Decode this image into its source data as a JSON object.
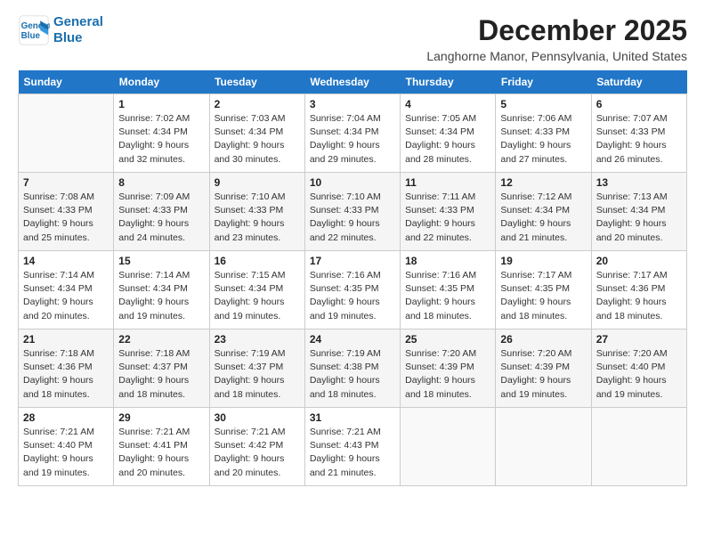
{
  "logo": {
    "line1": "General",
    "line2": "Blue"
  },
  "title": "December 2025",
  "location": "Langhorne Manor, Pennsylvania, United States",
  "days_of_week": [
    "Sunday",
    "Monday",
    "Tuesday",
    "Wednesday",
    "Thursday",
    "Friday",
    "Saturday"
  ],
  "weeks": [
    [
      {
        "day": "",
        "info": ""
      },
      {
        "day": "1",
        "info": "Sunrise: 7:02 AM\nSunset: 4:34 PM\nDaylight: 9 hours\nand 32 minutes."
      },
      {
        "day": "2",
        "info": "Sunrise: 7:03 AM\nSunset: 4:34 PM\nDaylight: 9 hours\nand 30 minutes."
      },
      {
        "day": "3",
        "info": "Sunrise: 7:04 AM\nSunset: 4:34 PM\nDaylight: 9 hours\nand 29 minutes."
      },
      {
        "day": "4",
        "info": "Sunrise: 7:05 AM\nSunset: 4:34 PM\nDaylight: 9 hours\nand 28 minutes."
      },
      {
        "day": "5",
        "info": "Sunrise: 7:06 AM\nSunset: 4:33 PM\nDaylight: 9 hours\nand 27 minutes."
      },
      {
        "day": "6",
        "info": "Sunrise: 7:07 AM\nSunset: 4:33 PM\nDaylight: 9 hours\nand 26 minutes."
      }
    ],
    [
      {
        "day": "7",
        "info": "Sunrise: 7:08 AM\nSunset: 4:33 PM\nDaylight: 9 hours\nand 25 minutes."
      },
      {
        "day": "8",
        "info": "Sunrise: 7:09 AM\nSunset: 4:33 PM\nDaylight: 9 hours\nand 24 minutes."
      },
      {
        "day": "9",
        "info": "Sunrise: 7:10 AM\nSunset: 4:33 PM\nDaylight: 9 hours\nand 23 minutes."
      },
      {
        "day": "10",
        "info": "Sunrise: 7:10 AM\nSunset: 4:33 PM\nDaylight: 9 hours\nand 22 minutes."
      },
      {
        "day": "11",
        "info": "Sunrise: 7:11 AM\nSunset: 4:33 PM\nDaylight: 9 hours\nand 22 minutes."
      },
      {
        "day": "12",
        "info": "Sunrise: 7:12 AM\nSunset: 4:34 PM\nDaylight: 9 hours\nand 21 minutes."
      },
      {
        "day": "13",
        "info": "Sunrise: 7:13 AM\nSunset: 4:34 PM\nDaylight: 9 hours\nand 20 minutes."
      }
    ],
    [
      {
        "day": "14",
        "info": "Sunrise: 7:14 AM\nSunset: 4:34 PM\nDaylight: 9 hours\nand 20 minutes."
      },
      {
        "day": "15",
        "info": "Sunrise: 7:14 AM\nSunset: 4:34 PM\nDaylight: 9 hours\nand 19 minutes."
      },
      {
        "day": "16",
        "info": "Sunrise: 7:15 AM\nSunset: 4:34 PM\nDaylight: 9 hours\nand 19 minutes."
      },
      {
        "day": "17",
        "info": "Sunrise: 7:16 AM\nSunset: 4:35 PM\nDaylight: 9 hours\nand 19 minutes."
      },
      {
        "day": "18",
        "info": "Sunrise: 7:16 AM\nSunset: 4:35 PM\nDaylight: 9 hours\nand 18 minutes."
      },
      {
        "day": "19",
        "info": "Sunrise: 7:17 AM\nSunset: 4:35 PM\nDaylight: 9 hours\nand 18 minutes."
      },
      {
        "day": "20",
        "info": "Sunrise: 7:17 AM\nSunset: 4:36 PM\nDaylight: 9 hours\nand 18 minutes."
      }
    ],
    [
      {
        "day": "21",
        "info": "Sunrise: 7:18 AM\nSunset: 4:36 PM\nDaylight: 9 hours\nand 18 minutes."
      },
      {
        "day": "22",
        "info": "Sunrise: 7:18 AM\nSunset: 4:37 PM\nDaylight: 9 hours\nand 18 minutes."
      },
      {
        "day": "23",
        "info": "Sunrise: 7:19 AM\nSunset: 4:37 PM\nDaylight: 9 hours\nand 18 minutes."
      },
      {
        "day": "24",
        "info": "Sunrise: 7:19 AM\nSunset: 4:38 PM\nDaylight: 9 hours\nand 18 minutes."
      },
      {
        "day": "25",
        "info": "Sunrise: 7:20 AM\nSunset: 4:39 PM\nDaylight: 9 hours\nand 18 minutes."
      },
      {
        "day": "26",
        "info": "Sunrise: 7:20 AM\nSunset: 4:39 PM\nDaylight: 9 hours\nand 19 minutes."
      },
      {
        "day": "27",
        "info": "Sunrise: 7:20 AM\nSunset: 4:40 PM\nDaylight: 9 hours\nand 19 minutes."
      }
    ],
    [
      {
        "day": "28",
        "info": "Sunrise: 7:21 AM\nSunset: 4:40 PM\nDaylight: 9 hours\nand 19 minutes."
      },
      {
        "day": "29",
        "info": "Sunrise: 7:21 AM\nSunset: 4:41 PM\nDaylight: 9 hours\nand 20 minutes."
      },
      {
        "day": "30",
        "info": "Sunrise: 7:21 AM\nSunset: 4:42 PM\nDaylight: 9 hours\nand 20 minutes."
      },
      {
        "day": "31",
        "info": "Sunrise: 7:21 AM\nSunset: 4:43 PM\nDaylight: 9 hours\nand 21 minutes."
      },
      {
        "day": "",
        "info": ""
      },
      {
        "day": "",
        "info": ""
      },
      {
        "day": "",
        "info": ""
      }
    ]
  ]
}
